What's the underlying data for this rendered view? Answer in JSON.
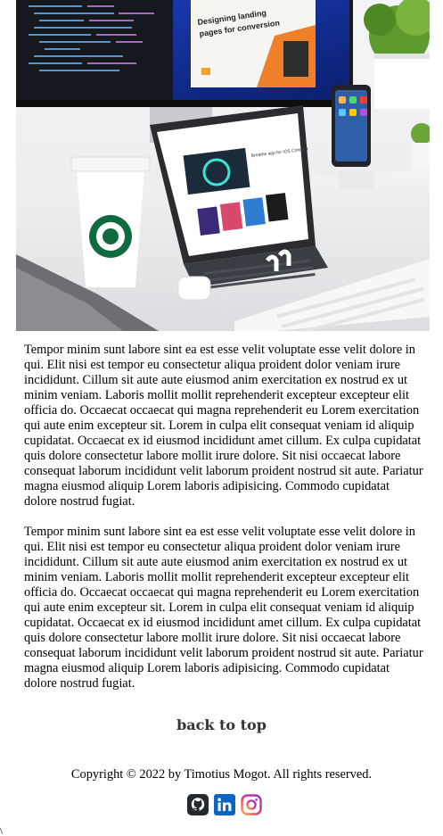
{
  "hero": {
    "screen_heading": "Designing landing pages for conversion",
    "tablet_heading": "Breathe app for iOS Concept"
  },
  "content": {
    "paragraphs": [
      "Tempor minim sunt labore sint ea est esse velit voluptate esse velit dolore in qui. Elit nisi est tempor eu consectetur aliqua proident dolor veniam irure incididunt. Cillum sit aute aute eiusmod anim exercitation ex nostrud ex ut minim veniam. Laboris mollit mollit reprehenderit excepteur excepteur elit officia do. Occaecat occaecat qui magna reprehenderit eu Lorem exercitation qui aute enim excepteur sit. Lorem in culpa elit consequat veniam id aliquip cupidatat. Occaecat ex id eiusmod incididunt amet cillum. Ex culpa cupidatat quis dolore consectetur labore mollit irure dolore. Sit nisi occaecat labore consequat laborum incididunt velit laborum proident nostrud sit aute. Pariatur magna eiusmod aliquip Lorem laboris adipisicing. Commodo cupidatat dolore nostrud fugiat.",
      "Tempor minim sunt labore sint ea est esse velit voluptate esse velit dolore in qui. Elit nisi est tempor eu consectetur aliqua proident dolor veniam irure incididunt. Cillum sit aute aute eiusmod anim exercitation ex nostrud ex ut minim veniam. Laboris mollit mollit reprehenderit excepteur excepteur elit officia do. Occaecat occaecat qui magna reprehenderit eu Lorem exercitation qui aute enim excepteur sit. Lorem in culpa elit consequat veniam id aliquip cupidatat. Occaecat ex id eiusmod incididunt amet cillum. Ex culpa cupidatat quis dolore consectetur labore mollit irure dolore. Sit nisi occaecat labore consequat laborum incididunt velit laborum proident nostrud sit aute. Pariatur magna eiusmod aliquip Lorem laboris adipisicing. Commodo cupidatat dolore nostrud fugiat."
    ]
  },
  "footer": {
    "back_to_top": "back to top",
    "copyright": "Copyright © 2022 by Timotius Mogot. All rights reserved.",
    "edge_char": "\\",
    "social": [
      {
        "icon": "github-icon",
        "color": "#24292e"
      },
      {
        "icon": "linkedin-icon",
        "color": "#0a66c2"
      },
      {
        "icon": "instagram-icon",
        "color": "#d6249f"
      }
    ]
  }
}
